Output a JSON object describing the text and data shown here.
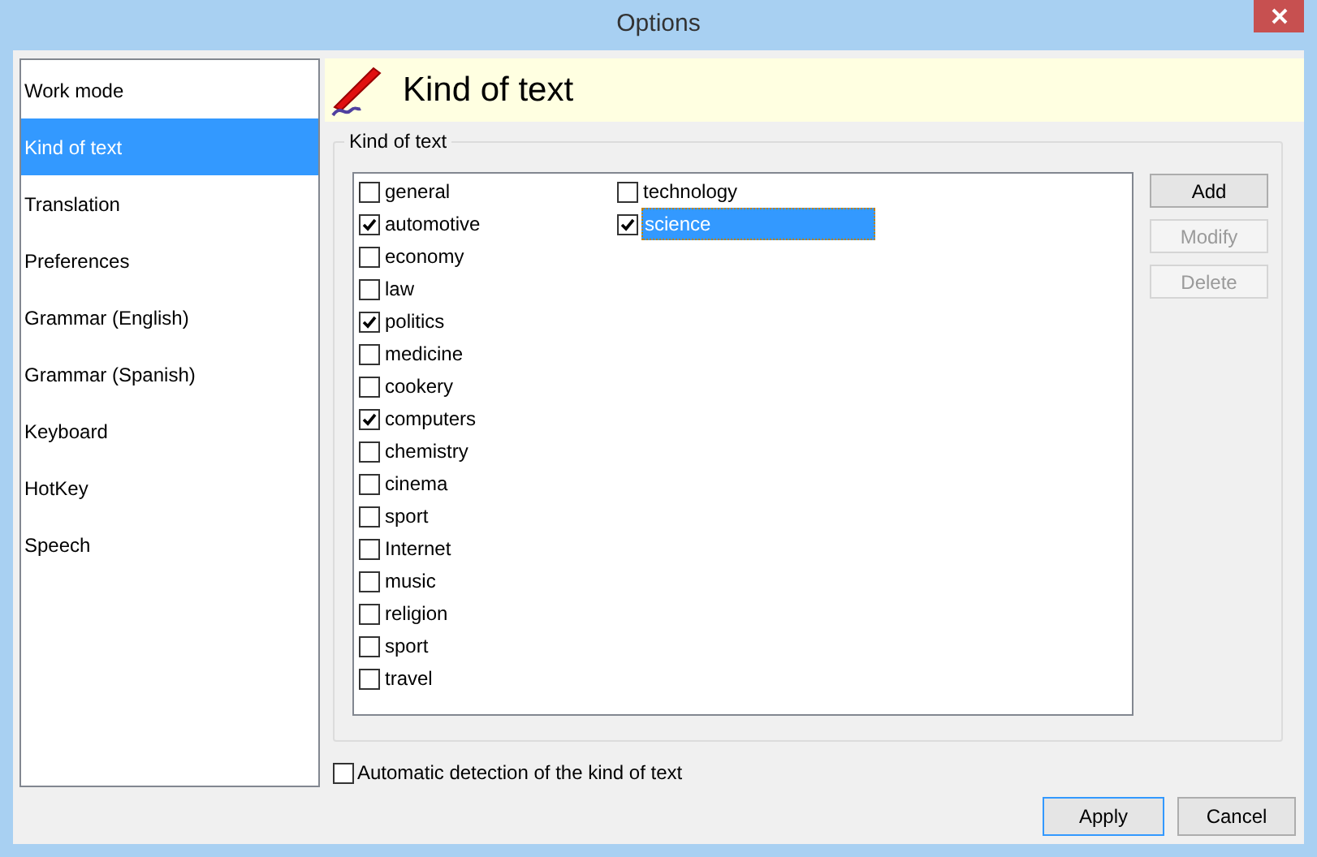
{
  "window": {
    "title": "Options"
  },
  "sidebar": {
    "items": [
      {
        "label": "Work mode",
        "selected": false
      },
      {
        "label": "Kind of text",
        "selected": true
      },
      {
        "label": "Translation",
        "selected": false
      },
      {
        "label": "Preferences",
        "selected": false
      },
      {
        "label": "Grammar (English)",
        "selected": false
      },
      {
        "label": "Grammar (Spanish)",
        "selected": false
      },
      {
        "label": "Keyboard",
        "selected": false
      },
      {
        "label": "HotKey",
        "selected": false
      },
      {
        "label": "Speech",
        "selected": false
      }
    ]
  },
  "header": {
    "title": "Kind of text"
  },
  "group": {
    "title": "Kind of text",
    "columns": [
      [
        {
          "label": "general",
          "checked": false,
          "selected": false
        },
        {
          "label": "automotive",
          "checked": true,
          "selected": false
        },
        {
          "label": "economy",
          "checked": false,
          "selected": false
        },
        {
          "label": "law",
          "checked": false,
          "selected": false
        },
        {
          "label": "politics",
          "checked": true,
          "selected": false
        },
        {
          "label": "medicine",
          "checked": false,
          "selected": false
        },
        {
          "label": "cookery",
          "checked": false,
          "selected": false
        },
        {
          "label": "computers",
          "checked": true,
          "selected": false
        },
        {
          "label": "chemistry",
          "checked": false,
          "selected": false
        },
        {
          "label": "cinema",
          "checked": false,
          "selected": false
        },
        {
          "label": "sport",
          "checked": false,
          "selected": false
        },
        {
          "label": "Internet",
          "checked": false,
          "selected": false
        },
        {
          "label": "music",
          "checked": false,
          "selected": false
        },
        {
          "label": "religion",
          "checked": false,
          "selected": false
        },
        {
          "label": "sport",
          "checked": false,
          "selected": false
        },
        {
          "label": "travel",
          "checked": false,
          "selected": false
        }
      ],
      [
        {
          "label": "technology",
          "checked": false,
          "selected": false
        },
        {
          "label": "science",
          "checked": true,
          "selected": true
        }
      ]
    ],
    "buttons": [
      {
        "label": "Add",
        "disabled": false
      },
      {
        "label": "Modify",
        "disabled": true
      },
      {
        "label": "Delete",
        "disabled": true
      }
    ]
  },
  "auto_detect": {
    "label": "Automatic detection of the kind of text",
    "checked": false
  },
  "footer_buttons": [
    {
      "label": "Apply",
      "default": true
    },
    {
      "label": "Cancel",
      "default": false
    }
  ]
}
